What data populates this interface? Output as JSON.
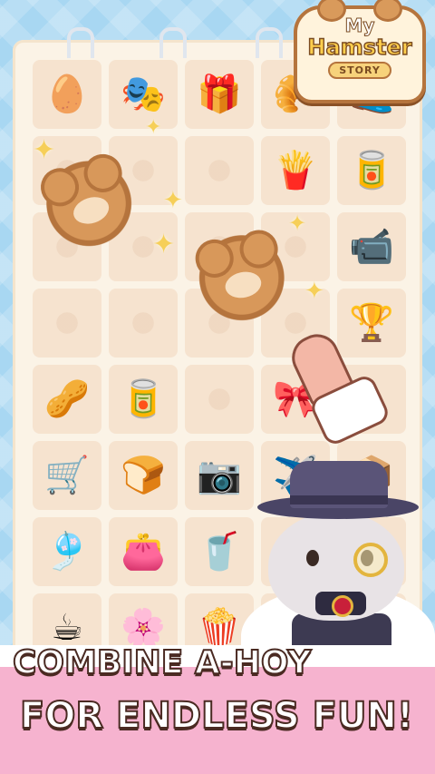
{
  "logo": {
    "line1": "My",
    "line2": "Hamster",
    "line3": "STORY"
  },
  "tagline": {
    "line1": "COMBINE A-HOY",
    "line2": "FOR ENDLESS FUN!"
  },
  "grid_items": [
    {
      "name": "egg-and-bread-item",
      "glyph": "🥚"
    },
    {
      "name": "face-mask-item",
      "glyph": "🎭"
    },
    {
      "name": "gift-bag-item",
      "glyph": "🎁"
    },
    {
      "name": "croissant-item",
      "glyph": "🥐"
    },
    {
      "name": "slipper-item",
      "glyph": "🥿"
    },
    {
      "name": "empty-cell",
      "glyph": ""
    },
    {
      "name": "empty-cell",
      "glyph": ""
    },
    {
      "name": "empty-cell",
      "glyph": ""
    },
    {
      "name": "snack-meal-item",
      "glyph": "🍟"
    },
    {
      "name": "hamster-can-item",
      "glyph": "🥫"
    },
    {
      "name": "empty-cell",
      "glyph": ""
    },
    {
      "name": "empty-cell",
      "glyph": ""
    },
    {
      "name": "empty-cell",
      "glyph": ""
    },
    {
      "name": "empty-cell",
      "glyph": ""
    },
    {
      "name": "camera-item",
      "glyph": "📹"
    },
    {
      "name": "empty-cell",
      "glyph": ""
    },
    {
      "name": "empty-cell",
      "glyph": ""
    },
    {
      "name": "empty-cell",
      "glyph": ""
    },
    {
      "name": "empty-cell",
      "glyph": ""
    },
    {
      "name": "golden-statue-item",
      "glyph": "🏆"
    },
    {
      "name": "pistachio-item",
      "glyph": "🥜"
    },
    {
      "name": "hamster-can-item",
      "glyph": "🥫"
    },
    {
      "name": "empty-cell",
      "glyph": ""
    },
    {
      "name": "toy-item",
      "glyph": "🎀"
    },
    {
      "name": "empty-cell",
      "glyph": ""
    },
    {
      "name": "luggage-cart-item",
      "glyph": "🛒"
    },
    {
      "name": "bread-item",
      "glyph": "🍞"
    },
    {
      "name": "bear-camera-item",
      "glyph": "📷"
    },
    {
      "name": "airplane-item",
      "glyph": "✈️"
    },
    {
      "name": "box-item",
      "glyph": "📦"
    },
    {
      "name": "wind-chime-item",
      "glyph": "🎐"
    },
    {
      "name": "cat-pouch-item",
      "glyph": "👛"
    },
    {
      "name": "smoothie-item",
      "glyph": "🥤"
    },
    {
      "name": "empty-cell",
      "glyph": ""
    },
    {
      "name": "empty-cell",
      "glyph": ""
    },
    {
      "name": "coffee-beans-item",
      "glyph": "☕"
    },
    {
      "name": "flower-pot-item",
      "glyph": "🌸"
    },
    {
      "name": "popcorn-item",
      "glyph": "🍿"
    },
    {
      "name": "empty-cell",
      "glyph": ""
    },
    {
      "name": "empty-cell",
      "glyph": ""
    }
  ],
  "colors": {
    "sky": "#a8d7f2",
    "board": "#fbf3e6",
    "cell": "#f6e3cf",
    "banner": "#f6b3cf",
    "tagline_stroke": "#4a2a22",
    "bear": "#d8985a"
  }
}
